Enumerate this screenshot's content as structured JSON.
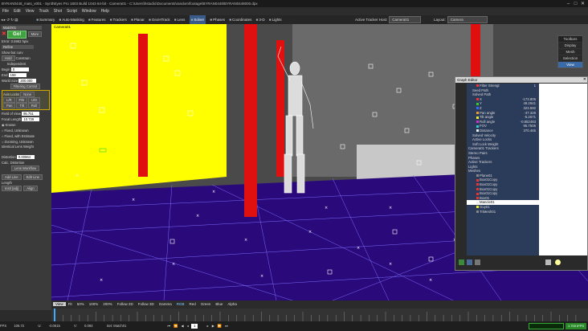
{
  "titlebar": {
    "text": "BYRAN0448_mats_v001 - SynthEyes Pro 1803 Build 1043 64-bit - Camera01 - C:\\Users\\hstudio\\Documents\\random\\footage\\BYRAN0448\\BYRAN0448000.dpx",
    "buttons": [
      "–",
      "□",
      "✕"
    ]
  },
  "menubar": [
    "File",
    "Edit",
    "View",
    "Track",
    "Shot",
    "Script",
    "Window",
    "Help"
  ],
  "toolbar": {
    "rooms": [
      "Summary",
      "Auto-Masking",
      "Features",
      "Trackers",
      "Planar",
      "GeoHTrack",
      "Lens",
      "Solver",
      "Phases",
      "Coordinates",
      "3-D",
      "Lights"
    ],
    "active_room": "Solver",
    "active_tracker_host_label": "Active Tracker Host:",
    "active_tracker_host_value": "Camera01",
    "layout_label": "Layout:",
    "layout_value": "Camera"
  },
  "leftpanel": {
    "object_select": "Match01",
    "go_label": "Go!",
    "more_label": "More",
    "error_label": "Error:",
    "error_value": "0.5962 hpix",
    "refine_select": "Refine",
    "show_but_curv": "Show but curv",
    "constrain": "Constrain",
    "hold": "Hold",
    "independent": "Independent",
    "begin_label": "Begin",
    "begin_value": "0",
    "end_label": "End",
    "end_value": "159",
    "world_size_label": "World Size",
    "world_size_value": "200.000",
    "filtering_control": "Filtering Control",
    "axis_locks": "Axis Locks",
    "axis_locks_none": "None",
    "axis_row1": [
      "L/R",
      "F/B",
      "U/D"
    ],
    "axis_row2": [
      "Pan",
      "Tilt",
      "Roll"
    ],
    "fov_label": "Field of View",
    "fov_value": "95.751",
    "focal_label": "Focal Length",
    "focal_value": "10.739",
    "lens_options": [
      "Known",
      "Fixed, Unknown",
      "Fixed, with Estimate",
      "Zooming, Unknown"
    ],
    "lens_selected": 0,
    "identical_lens_weight": "Identical Lens Weight",
    "distortion_label": "Distortion",
    "distortion_value": "0.00964",
    "calc_distortion": "Calc. Distortion",
    "lens_workflow": "Lens Workflow",
    "add_line": "Add Line",
    "edit_line": "Edit Line",
    "length_label": "Length",
    "instl_adj": "Instl (adj)",
    "align": "Align"
  },
  "viewport": {
    "camera_label": "Camera01",
    "toolbars_title": "Toolbars",
    "toolbars_items": [
      "Display",
      "Mesh",
      "Selection",
      "View"
    ],
    "toolbars_active": "View"
  },
  "grapheditor": {
    "title": "Graph Editor",
    "close": "✕",
    "nodes": [
      {
        "label": "Filter Strengt",
        "value": "1",
        "indent": 2,
        "swatch": "#e33"
      },
      {
        "label": "Seed Path",
        "value": "",
        "indent": 1,
        "swatch": ""
      },
      {
        "label": "Solved Path",
        "value": "",
        "indent": 1,
        "swatch": ""
      },
      {
        "label": "X",
        "value": "-173.805",
        "indent": 2,
        "swatch": "#e33"
      },
      {
        "label": "Y",
        "value": "49.2941",
        "indent": 2,
        "swatch": "#3c3"
      },
      {
        "label": "Z",
        "value": "323.592",
        "indent": 2,
        "swatch": "#36f"
      },
      {
        "label": "Pan angle",
        "value": "-37.329",
        "indent": 2,
        "swatch": "#e93"
      },
      {
        "label": "Tilt angle",
        "value": "-5.2671",
        "indent": 2,
        "swatch": "#ee3"
      },
      {
        "label": "Roll angle",
        "value": "-0.852483",
        "indent": 2,
        "swatch": "#c3c"
      },
      {
        "label": "FOV",
        "value": "95.7506",
        "indent": 2,
        "swatch": "#3cc"
      },
      {
        "label": "Distance",
        "value": "370.465",
        "indent": 2,
        "swatch": "#eee"
      },
      {
        "label": "Solved Velocity",
        "value": "",
        "indent": 1,
        "swatch": ""
      },
      {
        "label": "Active Locks",
        "value": "",
        "indent": 1,
        "swatch": ""
      },
      {
        "label": "Soft Lock Weight",
        "value": "",
        "indent": 1,
        "swatch": ""
      },
      {
        "label": "Camera01 Trackers",
        "value": "",
        "indent": 0,
        "swatch": ""
      },
      {
        "label": "Stereo Pairs",
        "value": "",
        "indent": 0,
        "swatch": ""
      },
      {
        "label": "Phases",
        "value": "",
        "indent": 0,
        "swatch": ""
      },
      {
        "label": "Active Trackers",
        "value": "",
        "indent": 0,
        "swatch": ""
      },
      {
        "label": "Lights",
        "value": "",
        "indent": 0,
        "swatch": ""
      },
      {
        "label": "Meshes",
        "value": "",
        "indent": 0,
        "swatch": ""
      },
      {
        "label": "Plane01",
        "value": "",
        "indent": 2,
        "swatch": "#888"
      },
      {
        "label": "Box01Copy",
        "value": "",
        "indent": 2,
        "swatch": "#e33"
      },
      {
        "label": "Box01Copy",
        "value": "",
        "indent": 2,
        "swatch": "#e33"
      },
      {
        "label": "Box01Copy",
        "value": "",
        "indent": 2,
        "swatch": "#e33"
      },
      {
        "label": "Box01Copy",
        "value": "",
        "indent": 2,
        "swatch": "#e33"
      },
      {
        "label": "Box01",
        "value": "",
        "indent": 2,
        "swatch": "#e33"
      },
      {
        "label": "Mancle01",
        "value": "",
        "indent": 2,
        "swatch": "#eee",
        "selected": true
      },
      {
        "label": "Guy01",
        "value": "",
        "indent": 2,
        "swatch": "#ee3"
      },
      {
        "label": "TriMesh01",
        "value": "",
        "indent": 2,
        "swatch": "#888"
      }
    ]
  },
  "viewport_tabs": {
    "items": [
      "View",
      "Fit",
      "50%",
      "100%",
      "200%",
      "Follow 2D",
      "Follow 3D",
      "Gamma",
      "RGB",
      "Red",
      "Green",
      "Blue",
      "Alpha"
    ],
    "active": "View",
    "highlight": "RGB"
  },
  "statusbar": {
    "fps_label": "FPS",
    "fps_value": "106.72",
    "xy_label": "U:",
    "x_value": "-0.0615",
    "v_label": "V:",
    "y_value": "0.093",
    "set_label": "Set: Match01",
    "transport": [
      "⏮",
      "⏪",
      "◀",
      "◂",
      "▸",
      "▶",
      "⏩",
      "⏭"
    ],
    "frame": "1",
    "fps_meter": "1.700 tFPS"
  },
  "colors": {
    "yellow_wall": "#ffff00",
    "red_pillar": "#e01010",
    "ground_mesh": "#2a0a7a",
    "mesh_lines": "#7a6aff",
    "accent_blue": "#3a6aa8",
    "go_green": "#3fa33f"
  }
}
